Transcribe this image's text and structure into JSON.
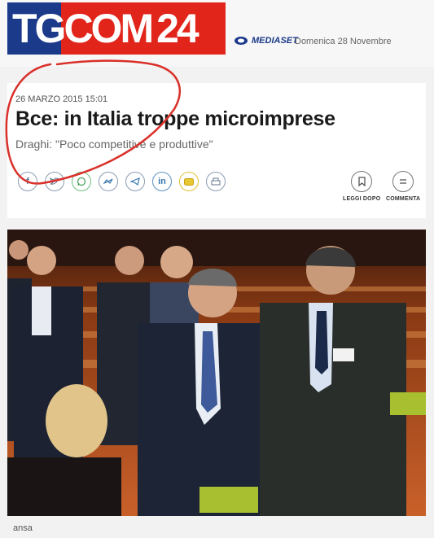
{
  "header": {
    "logo_tg": "TG",
    "logo_com": "COM",
    "logo_24": "24",
    "publisher": "MEDIASET",
    "date": "Domenica 28 Novembre"
  },
  "article": {
    "kicker": "26 MARZO 2015 15:01",
    "title": "Bce: in Italia troppe microimprese",
    "subtitle": "Draghi: \"Poco competitive e produttive\"",
    "photo_credit": "ansa"
  },
  "share_icons": [
    "facebook-icon",
    "twitter-icon",
    "whatsapp-icon",
    "messenger-icon",
    "telegram-icon",
    "linkedin-icon",
    "email-icon",
    "print-icon"
  ],
  "tools": {
    "read_later": "LEGGI DOPO",
    "comment": "COMMENTA"
  },
  "colors": {
    "logo_blue": "#1b3a8a",
    "logo_red": "#e1251b",
    "annotation_red": "#d9302a"
  }
}
